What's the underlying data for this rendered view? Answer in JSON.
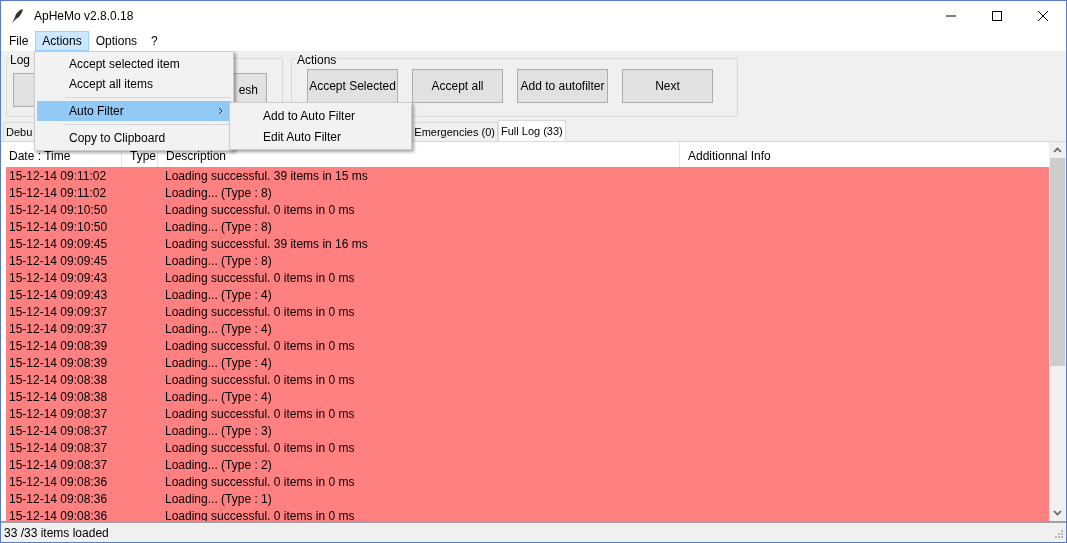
{
  "window": {
    "title": "ApHeMo v2.8.0.18"
  },
  "menu": [
    {
      "label": "File",
      "selected": false
    },
    {
      "label": "Actions",
      "selected": true
    },
    {
      "label": "Options",
      "selected": false
    },
    {
      "label": "?",
      "selected": false
    }
  ],
  "dropdown": [
    {
      "kind": "item",
      "label": "Accept selected item",
      "highlighted": false,
      "submenu": false
    },
    {
      "kind": "item",
      "label": "Accept all items",
      "highlighted": false,
      "submenu": false
    },
    {
      "kind": "separator"
    },
    {
      "kind": "item",
      "label": "Auto Filter",
      "highlighted": true,
      "submenu": true
    },
    {
      "kind": "separator"
    },
    {
      "kind": "item",
      "label": "Copy to Clipboard",
      "highlighted": false,
      "submenu": false
    }
  ],
  "submenu": [
    "Add to Auto Filter",
    "Edit Auto Filter"
  ],
  "log_group": {
    "title": "Log",
    "buttons": [
      {
        "label": "esh"
      }
    ]
  },
  "actions_group": {
    "title": "Actions",
    "buttons": [
      "Accept Selected",
      "Accept all",
      "Add to autofilter",
      "Next"
    ]
  },
  "tabs": [
    {
      "label": "Debu",
      "selected": false
    },
    {
      "label": "Emergencies (0)",
      "selected": false
    },
    {
      "label": "Full Log (33)",
      "selected": true
    }
  ],
  "table": {
    "columns": [
      "Date : Time",
      "Type",
      "Description",
      "Additionnal Info"
    ],
    "rows": [
      [
        "15-12-14 09:11:02",
        "Loading successful. 39 items in 15 ms"
      ],
      [
        "15-12-14 09:11:02",
        "Loading... (Type : 8)"
      ],
      [
        "15-12-14 09:10:50",
        "Loading successful. 0 items in 0 ms"
      ],
      [
        "15-12-14 09:10:50",
        "Loading... (Type : 8)"
      ],
      [
        "15-12-14 09:09:45",
        "Loading successful. 39 items in 16 ms"
      ],
      [
        "15-12-14 09:09:45",
        "Loading... (Type : 8)"
      ],
      [
        "15-12-14 09:09:43",
        "Loading successful. 0 items in 0 ms"
      ],
      [
        "15-12-14 09:09:43",
        "Loading... (Type : 4)"
      ],
      [
        "15-12-14 09:09:37",
        "Loading successful. 0 items in 0 ms"
      ],
      [
        "15-12-14 09:09:37",
        "Loading... (Type : 4)"
      ],
      [
        "15-12-14 09:08:39",
        "Loading successful. 0 items in 0 ms"
      ],
      [
        "15-12-14 09:08:39",
        "Loading... (Type : 4)"
      ],
      [
        "15-12-14 09:08:38",
        "Loading successful. 0 items in 0 ms"
      ],
      [
        "15-12-14 09:08:38",
        "Loading... (Type : 4)"
      ],
      [
        "15-12-14 09:08:37",
        "Loading successful. 0 items in 0 ms"
      ],
      [
        "15-12-14 09:08:37",
        "Loading... (Type : 3)"
      ],
      [
        "15-12-14 09:08:37",
        "Loading successful. 0 items in 0 ms"
      ],
      [
        "15-12-14 09:08:37",
        "Loading... (Type : 2)"
      ],
      [
        "15-12-14 09:08:36",
        "Loading successful. 0 items in 0 ms"
      ],
      [
        "15-12-14 09:08:36",
        "Loading... (Type : 1)"
      ],
      [
        "15-12-14 09:08:36",
        "Loading successful. 0 items in 0 ms"
      ]
    ]
  },
  "status_bar": "33 /33 items loaded"
}
